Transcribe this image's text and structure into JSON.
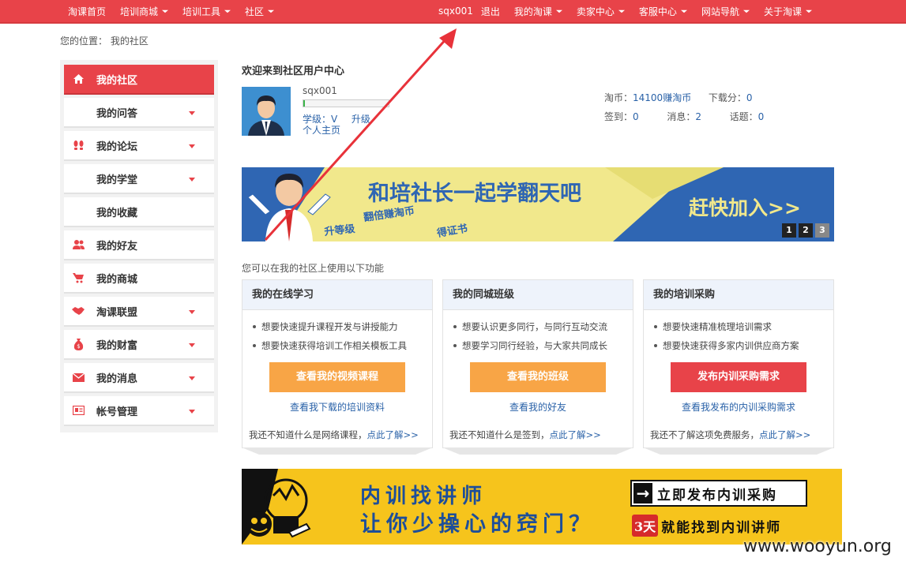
{
  "topnav": {
    "left": [
      {
        "label": "淘课首页",
        "caret": false
      },
      {
        "label": "培训商城",
        "caret": true
      },
      {
        "label": "培训工具",
        "caret": true
      },
      {
        "label": "社区",
        "caret": true
      }
    ],
    "username": "sqx001",
    "logout": "退出",
    "right": [
      {
        "label": "我的淘课",
        "caret": true
      },
      {
        "label": "卖家中心",
        "caret": true
      },
      {
        "label": "客服中心",
        "caret": true
      },
      {
        "label": "网站导航",
        "caret": true
      },
      {
        "label": "关于淘课",
        "caret": true
      }
    ]
  },
  "breadcrumb": {
    "prefix": "您的位置：",
    "current": "我的社区"
  },
  "sidebar": {
    "items": [
      {
        "label": "我的社区",
        "icon": "home-icon",
        "glyph": "⌂",
        "active": true,
        "arrow": false
      },
      {
        "label": "我的问答",
        "icon": "",
        "glyph": "",
        "active": false,
        "arrow": true
      },
      {
        "label": "我的论坛",
        "icon": "footprints-icon",
        "glyph": "❚❚",
        "active": false,
        "arrow": true
      },
      {
        "label": "我的学堂",
        "icon": "",
        "glyph": "",
        "active": false,
        "arrow": true
      },
      {
        "label": "我的收藏",
        "icon": "",
        "glyph": "",
        "active": false,
        "arrow": false
      },
      {
        "label": "我的好友",
        "icon": "friends-icon",
        "glyph": "◉",
        "active": false,
        "arrow": false
      },
      {
        "label": "我的商城",
        "icon": "cart-icon",
        "glyph": "⛟",
        "active": false,
        "arrow": false
      },
      {
        "label": "淘课联盟",
        "icon": "handshake-icon",
        "glyph": "✋",
        "active": false,
        "arrow": true
      },
      {
        "label": "我的财富",
        "icon": "money-bag-icon",
        "glyph": "$",
        "active": false,
        "arrow": true
      },
      {
        "label": "我的消息",
        "icon": "envelope-icon",
        "glyph": "✉",
        "active": false,
        "arrow": true
      },
      {
        "label": "帐号管理",
        "icon": "id-card-icon",
        "glyph": "▣",
        "active": false,
        "arrow": true
      }
    ]
  },
  "profile": {
    "welcome": "欢迎来到社区用户中心",
    "username": "sqx001",
    "progress": 0.02,
    "level_label": "学级：",
    "level_value": "V",
    "upgrade": "升级",
    "homepage": "个人主页"
  },
  "stats": {
    "coin_label": "淘币：",
    "coin_value": "14100",
    "earn": "赚淘币",
    "download_label": "下载分：",
    "download_value": "0",
    "signin_label": "签到：",
    "signin_value": "0",
    "message_label": "消息：",
    "message_value": "2",
    "topic_label": "话题：",
    "topic_value": "0"
  },
  "banner": {
    "headline": "和培社长一起学翻天吧",
    "cta": "赶快加入>>",
    "tag1": "翻倍赚淘币",
    "tag2": "升等级",
    "tag3": "得证书",
    "pages": [
      "1",
      "2",
      "3"
    ],
    "active_page": "3"
  },
  "func_tip": "您可以在我的社区上使用以下功能",
  "cards": [
    {
      "title": "我的在线学习",
      "bullets": [
        "想要快速提升课程开发与讲授能力",
        "想要快速获得培训工作相关模板工具"
      ],
      "button": "查看我的视频课程",
      "button_color": "#f8a546",
      "link": "查看我下载的培训资料",
      "foot_text": "我还不知道什么是网络课程，",
      "foot_link": "点此了解>>"
    },
    {
      "title": "我的同城班级",
      "bullets": [
        "想要认识更多同行，与同行互动交流",
        "想要学习同行经验，与大家共同成长"
      ],
      "button": "查看我的班级",
      "button_color": "#f8a546",
      "link": "查看我的好友",
      "foot_text": "我还不知道什么是签到，",
      "foot_link": "点此了解>>"
    },
    {
      "title": "我的培训采购",
      "bullets": [
        "想要快速精准梳理培训需求",
        "想要快速获得多家内训供应商方案"
      ],
      "button": "发布内训采购需求",
      "button_color": "#e84349",
      "link": "查看我发布的内训采购需求",
      "foot_text": "我还不了解这项免费服务，",
      "foot_link": "点此了解>>"
    }
  ],
  "bottom_banner": {
    "line1": "内训找讲师",
    "line2": "让你少操心的窍门？",
    "cta": "立即发布内训采购",
    "days_badge": "3天",
    "days_text": "就能找到内训讲师"
  },
  "watermark": "www.wooyun.org",
  "colors": {
    "brand_red": "#e84349",
    "link_blue": "#2a62a8",
    "orange": "#f8a546",
    "banner_yellow": "#f6c41c"
  }
}
